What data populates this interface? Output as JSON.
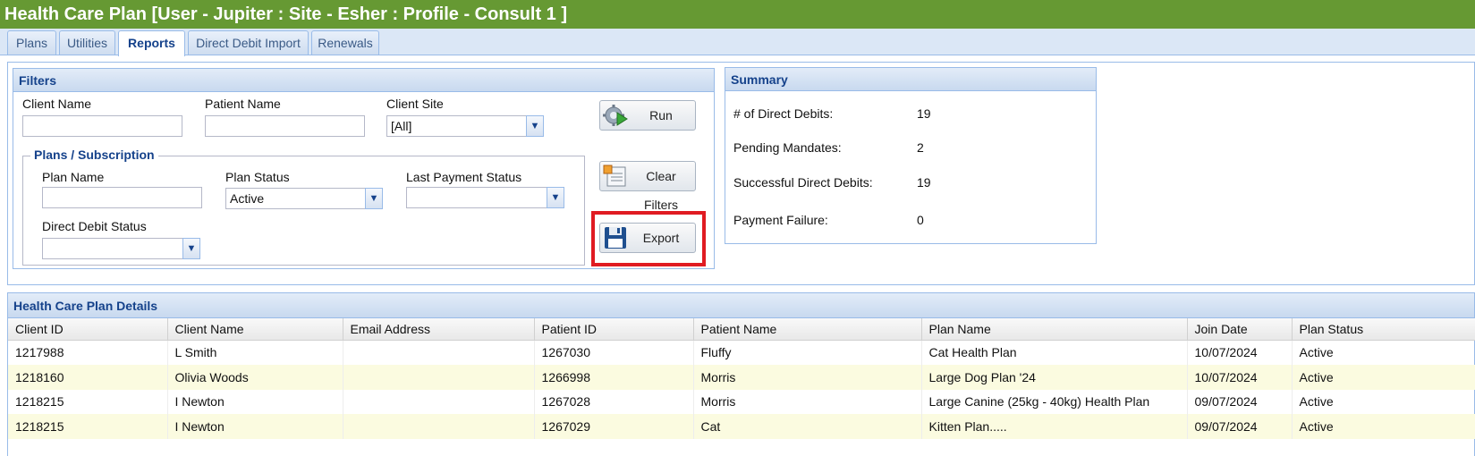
{
  "window": {
    "title": "Health Care Plan [User - Jupiter : Site - Esher : Profile - Consult 1 ]"
  },
  "tabs": [
    {
      "label": "Plans"
    },
    {
      "label": "Utilities"
    },
    {
      "label": "Reports",
      "active": true
    },
    {
      "label": "Direct Debit Import"
    },
    {
      "label": "Renewals"
    }
  ],
  "filters": {
    "title": "Filters",
    "client_name_label": "Client Name",
    "client_name_value": "",
    "patient_name_label": "Patient Name",
    "patient_name_value": "",
    "client_site_label": "Client Site",
    "client_site_value": "[All]",
    "plans_group": {
      "legend": "Plans / Subscription",
      "plan_name_label": "Plan Name",
      "plan_name_value": "",
      "plan_status_label": "Plan Status",
      "plan_status_value": "Active",
      "last_payment_status_label": "Last Payment Status",
      "last_payment_status_value": "",
      "direct_debit_status_label": "Direct Debit Status",
      "direct_debit_status_value": ""
    }
  },
  "buttons": {
    "run": "Run",
    "clear_filters": "Clear Filters",
    "export": "Export"
  },
  "summary": {
    "title": "Summary",
    "rows": [
      {
        "label": "# of Direct Debits:",
        "value": "19"
      },
      {
        "label": "Pending Mandates:",
        "value": "2"
      },
      {
        "label": "Successful Direct Debits:",
        "value": "19"
      },
      {
        "label": "Payment Failure:",
        "value": "0"
      }
    ]
  },
  "details": {
    "title": "Health Care Plan Details",
    "columns": [
      "Client ID",
      "Client Name",
      "Email Address",
      "Patient ID",
      "Patient Name",
      "Plan Name",
      "Join Date",
      "Plan Status"
    ],
    "rows": [
      [
        "1217988",
        "L Smith",
        "",
        "1267030",
        "Fluffy",
        "Cat Health Plan",
        "10/07/2024",
        "Active"
      ],
      [
        "1218160",
        "Olivia Woods",
        "",
        "1266998",
        "Morris",
        "Large Dog Plan '24",
        "10/07/2024",
        "Active"
      ],
      [
        "1218215",
        "I Newton",
        "",
        "1267028",
        "Morris",
        "Large Canine (25kg - 40kg) Health Plan",
        "09/07/2024",
        "Active"
      ],
      [
        "1218215",
        "I Newton",
        "",
        "1267029",
        "Cat",
        "Kitten Plan.....",
        "09/07/2024",
        "Active"
      ]
    ]
  },
  "colors": {
    "title_bar": "#669933",
    "panel_header_text": "#15428b",
    "highlight": "#e01b22",
    "alt_row": "#fbfbe0"
  }
}
